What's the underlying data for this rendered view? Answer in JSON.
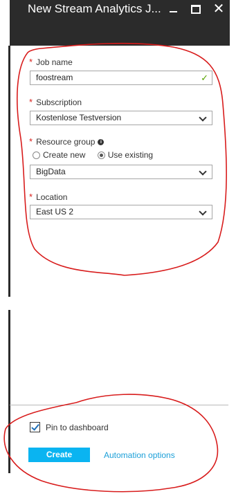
{
  "window": {
    "title": "New Stream Analytics J...",
    "close_glyph": "✕"
  },
  "form": {
    "job_name": {
      "label": "Job name",
      "value": "foostream",
      "valid_icon": "✓"
    },
    "subscription": {
      "label": "Subscription",
      "value": "Kostenlose Testversion"
    },
    "resource_group": {
      "label": "Resource group",
      "info_glyph": "i",
      "options": [
        "Create new",
        "Use existing"
      ],
      "selected_option": "Use existing",
      "value": "BigData"
    },
    "location": {
      "label": "Location",
      "value": "East US 2"
    },
    "required_mark": "*"
  },
  "footer": {
    "pin_label": "Pin to dashboard",
    "pin_checked": true,
    "create_label": "Create",
    "automation_label": "Automation options"
  },
  "colors": {
    "titlebar": "#2b2b2b",
    "required": "#d9201b",
    "valid": "#57a300",
    "create_button": "#0ab4f1",
    "link": "#1b9fd8",
    "annotation": "#d81c1c"
  }
}
